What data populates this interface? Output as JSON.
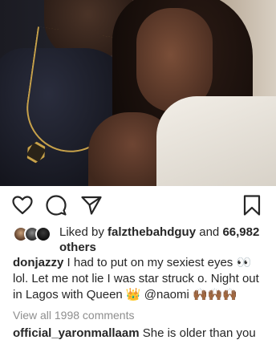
{
  "post": {
    "image_alt": ""
  },
  "actions": {
    "like_icon": "heart-outline-icon",
    "comment_icon": "comment-bubble-icon",
    "share_icon": "paper-plane-icon",
    "save_icon": "bookmark-outline-icon"
  },
  "likes": {
    "prefix": "Liked by ",
    "user": "falzthebahdguy",
    "middle": " and ",
    "count": "66,982",
    "suffix": "others"
  },
  "caption": {
    "username": "donjazzy",
    "text": " I had to put on my sexiest eyes 👀 lol. Let me not lie I was star struck o. Night out in Lagos with  Queen 👑 @naomi 🙌🏾🙌🏾🙌🏾"
  },
  "view_all": "View all 1998 comments",
  "comment": {
    "username": "official_yaronmallaam",
    "text": " She is older than you"
  }
}
